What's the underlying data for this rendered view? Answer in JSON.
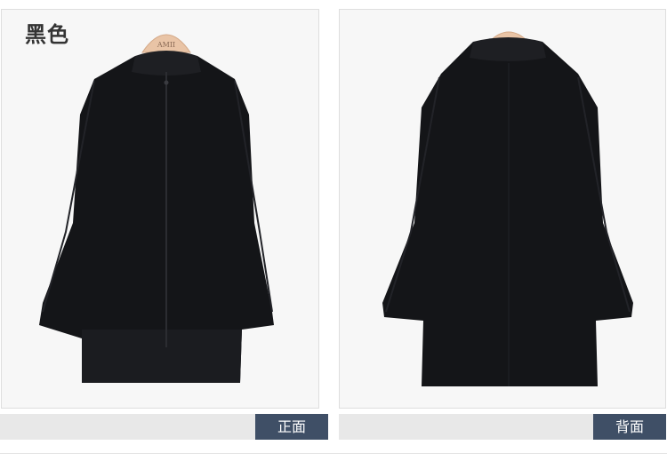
{
  "color_label": "黑色",
  "hanger_brand": "AMII",
  "views": {
    "front_label": "正面",
    "back_label": "背面"
  },
  "colors": {
    "garment": "#141518",
    "tag": "#3f4f66",
    "hanger": "#e9c4a6"
  }
}
